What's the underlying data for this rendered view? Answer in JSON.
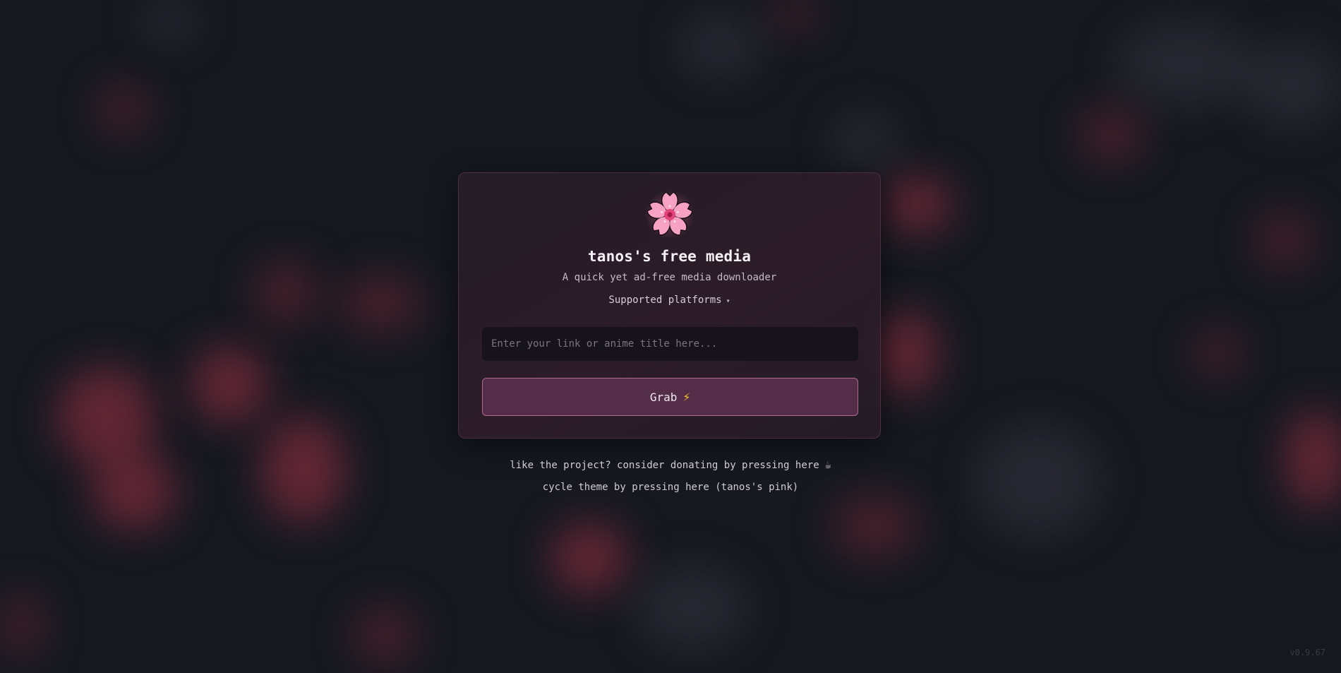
{
  "app": {
    "title": "tanos's free media",
    "subtitle": "A quick yet ad-free media downloader",
    "logo_icon": "cherry-blossom-icon"
  },
  "platforms": {
    "label": "Supported platforms",
    "caret": "▾"
  },
  "search": {
    "placeholder": "Enter your link or anime title here...",
    "value": ""
  },
  "grab_button": {
    "label": "Grab",
    "icon": "⚡"
  },
  "footer": {
    "donate_text": "like the project? consider donating by pressing here",
    "donate_icon": "☕",
    "theme_text": "cycle theme by pressing here (tanos's pink)"
  },
  "version": "v0.9.67",
  "colors": {
    "accent": "#b06a8f",
    "button_bg": "#542e48",
    "background": "#161820"
  }
}
